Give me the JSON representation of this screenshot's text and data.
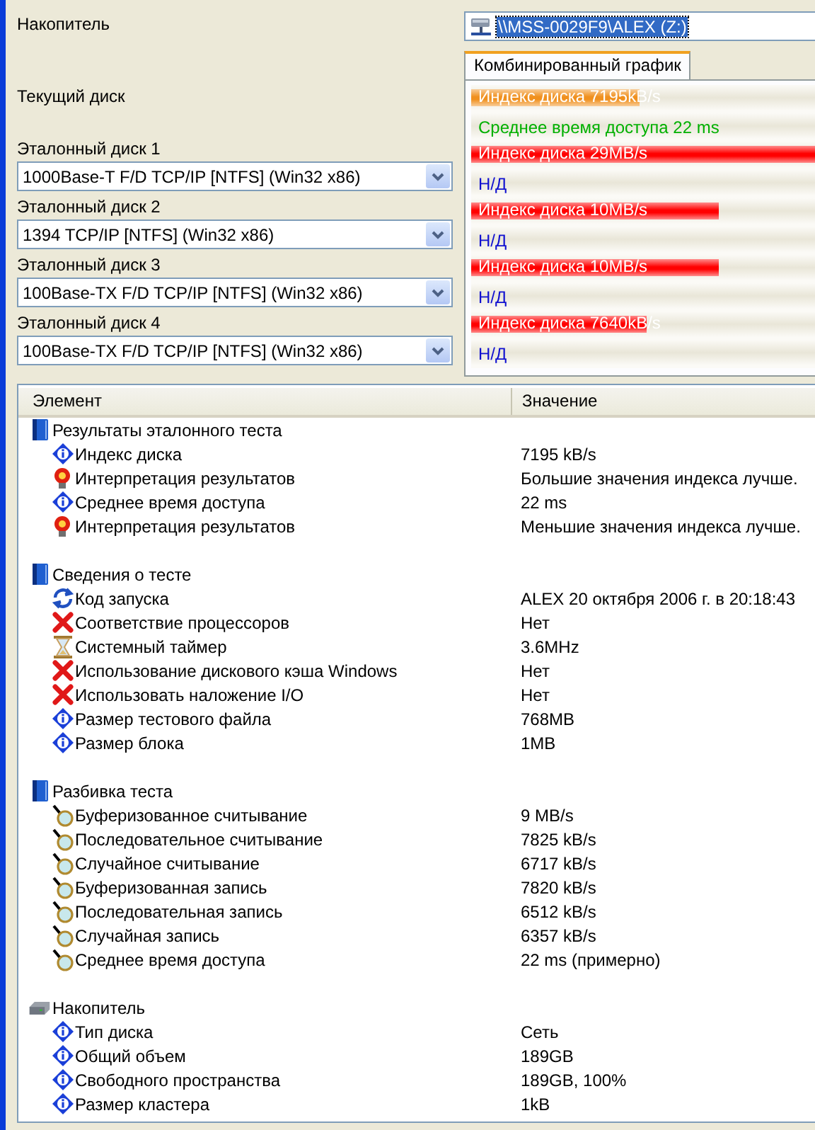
{
  "drive": {
    "label": "Накопитель",
    "value": "\\\\MSS-0029F9\\ALEX (Z:)",
    "selected": true
  },
  "current_disk": {
    "label": "Текущий диск"
  },
  "reference_disks": [
    {
      "label": "Эталонный диск 1",
      "value": "1000Base-T F/D TCP/IP [NTFS] (Win32 x86)"
    },
    {
      "label": "Эталонный диск 2",
      "value": "1394 TCP/IP [NTFS] (Win32 x86)"
    },
    {
      "label": "Эталонный диск 3",
      "value": "100Base-TX F/D TCP/IP [NTFS] (Win32 x86)"
    },
    {
      "label": "Эталонный диск 4",
      "value": "100Base-TX F/D TCP/IP [NTFS] (Win32 x86)"
    }
  ],
  "chart": {
    "tabs": [
      {
        "label": "Комбинированный график",
        "selected": true
      }
    ],
    "rows": [
      {
        "kind": "bar",
        "text": "Индекс диска 7195kB/s",
        "level": 0.49,
        "color": "#f0901e"
      },
      {
        "kind": "text",
        "text": "Среднее время доступа 22 ms",
        "color": "#00b000"
      },
      {
        "kind": "bar",
        "text": "Индекс диска 29MB/s",
        "level": 1,
        "color": "#ff0000"
      },
      {
        "kind": "text",
        "text": "Н/Д",
        "color": "#1010d0"
      },
      {
        "kind": "bar",
        "text": "Индекс диска 10MB/s",
        "level": 0.72,
        "color": "#ff0000"
      },
      {
        "kind": "text",
        "text": "Н/Д",
        "color": "#1010d0"
      },
      {
        "kind": "bar",
        "text": "Индекс диска 10MB/s",
        "level": 0.72,
        "color": "#ff0000"
      },
      {
        "kind": "text",
        "text": "Н/Д",
        "color": "#1010d0"
      },
      {
        "kind": "bar",
        "text": "Индекс диска 7640kB/s",
        "level": 0.51,
        "color": "#ff0000"
      },
      {
        "kind": "text",
        "text": "Н/Д",
        "color": "#1010d0"
      }
    ]
  },
  "details": {
    "columns": [
      "Элемент",
      "Значение"
    ],
    "groups": [
      {
        "kind": "book",
        "title": "Результаты эталонного теста",
        "children": [
          {
            "kind": "info",
            "name": "Индекс диска",
            "value": "7195 kB/s"
          },
          {
            "kind": "tip",
            "name": "Интерпретация результатов",
            "value": "Большие значения индекса лучше."
          },
          {
            "kind": "info",
            "name": "Среднее время доступа",
            "value": "22 ms"
          },
          {
            "kind": "tip",
            "name": "Интерпретация результатов",
            "value": "Меньшие значения индекса лучше."
          }
        ]
      },
      {
        "kind": "book",
        "title": "Сведения о тесте",
        "children": [
          {
            "kind": "refresh",
            "name": "Код запуска",
            "value": "ALEX 20 октября 2006 г. в 20:18:43"
          },
          {
            "kind": "fail",
            "name": "Соответствие процессоров",
            "value": "Нет"
          },
          {
            "kind": "timer",
            "name": "Системный таймер",
            "value": "3.6MHz"
          },
          {
            "kind": "fail",
            "name": "Использование дискового кэша Windows",
            "value": "Нет"
          },
          {
            "kind": "fail",
            "name": "Использовать наложение I/O",
            "value": "Нет"
          },
          {
            "kind": "info",
            "name": "Размер тестового файла",
            "value": "768MB"
          },
          {
            "kind": "info",
            "name": "Размер блока",
            "value": "1MB"
          }
        ]
      },
      {
        "kind": "book",
        "title": "Разбивка теста",
        "children": [
          {
            "kind": "measure",
            "name": "Буферизованное считывание",
            "value": "9 MB/s"
          },
          {
            "kind": "measure",
            "name": "Последовательное считывание",
            "value": "7825 kB/s"
          },
          {
            "kind": "measure",
            "name": "Случайное считывание",
            "value": "6717 kB/s"
          },
          {
            "kind": "measure",
            "name": "Буферизованная запись",
            "value": "7820 kB/s"
          },
          {
            "kind": "measure",
            "name": "Последовательная запись",
            "value": "6512 kB/s"
          },
          {
            "kind": "measure",
            "name": "Случайная запись",
            "value": "6357 kB/s"
          },
          {
            "kind": "measure",
            "name": "Среднее время доступа",
            "value": "22 ms (примерно)"
          }
        ]
      },
      {
        "kind": "drive",
        "title": "Накопитель",
        "children": [
          {
            "kind": "info",
            "name": "Тип диска",
            "value": "Сеть"
          },
          {
            "kind": "info",
            "name": "Общий объем",
            "value": "189GB"
          },
          {
            "kind": "info",
            "name": "Свободного пространства",
            "value": "189GB, 100%"
          },
          {
            "kind": "info",
            "name": "Размер кластера",
            "value": "1kB"
          }
        ]
      }
    ]
  }
}
